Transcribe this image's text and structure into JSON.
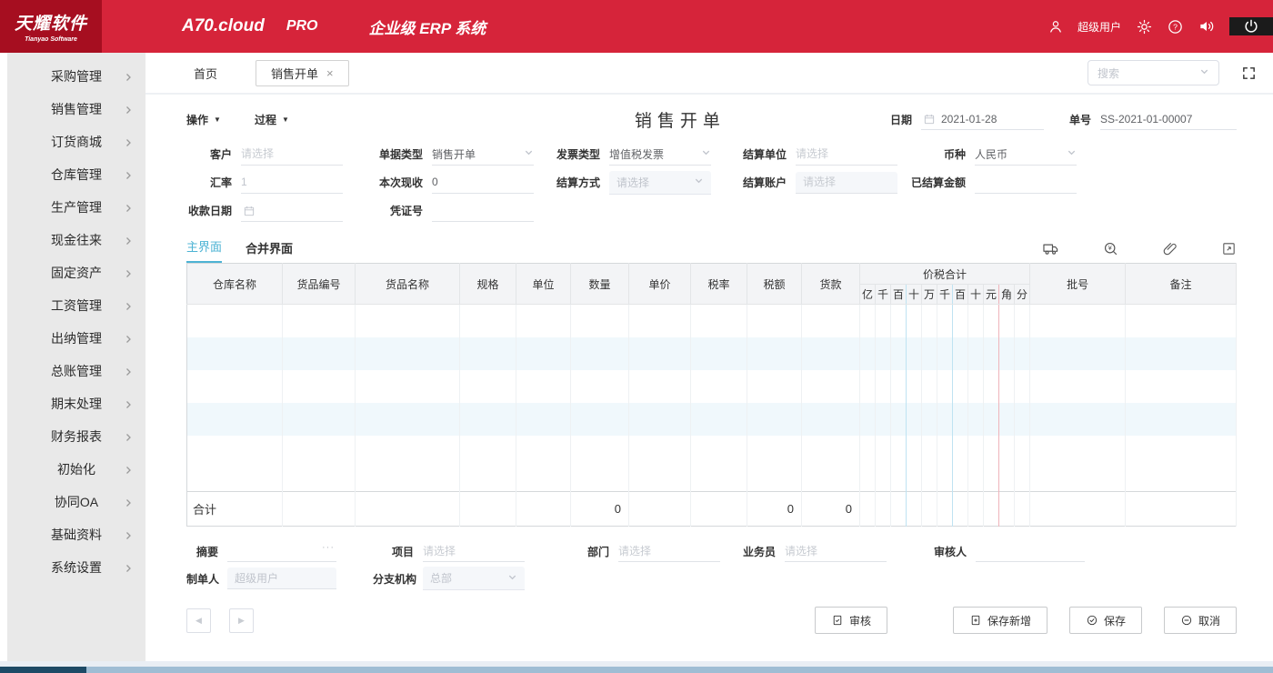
{
  "header": {
    "logo": {
      "title": "天耀软件",
      "subtitle": "Tianyao Software"
    },
    "product": "A70.cloud",
    "edition": "PRO",
    "system_name": "企业级 ERP 系统",
    "username": "超级用户"
  },
  "sidebar": {
    "items": [
      {
        "label": "采购管理"
      },
      {
        "label": "销售管理"
      },
      {
        "label": "订货商城"
      },
      {
        "label": "仓库管理"
      },
      {
        "label": "生产管理"
      },
      {
        "label": "现金往来"
      },
      {
        "label": "固定资产"
      },
      {
        "label": "工资管理"
      },
      {
        "label": "出纳管理"
      },
      {
        "label": "总账管理"
      },
      {
        "label": "期末处理"
      },
      {
        "label": "财务报表"
      },
      {
        "label": "初始化"
      },
      {
        "label": "协同OA"
      },
      {
        "label": "基础资料"
      },
      {
        "label": "系统设置"
      }
    ]
  },
  "tabbar": {
    "home": "首页",
    "active_tab": "销售开单",
    "close": "×",
    "search_placeholder": "搜索"
  },
  "toolbar": {
    "action_menu": "操作",
    "process_menu": "过程",
    "caret": "▼",
    "title": "销售开单",
    "date": {
      "label": "日期",
      "value": "2021-01-28"
    },
    "doc_no": {
      "label": "单号",
      "value": "SS-2021-01-00007"
    }
  },
  "form": {
    "customer": {
      "label": "客户",
      "placeholder": "请选择"
    },
    "doc_type": {
      "label": "单据类型",
      "value": "销售开单"
    },
    "invoice_type": {
      "label": "发票类型",
      "value": "增值税发票"
    },
    "settle_unit": {
      "label": "结算单位",
      "placeholder": "请选择"
    },
    "currency": {
      "label": "币种",
      "value": "人民币"
    },
    "exchange_rate": {
      "label": "汇率",
      "value": "1"
    },
    "cash_received": {
      "label": "本次现收",
      "value": "0"
    },
    "settle_method": {
      "label": "结算方式",
      "placeholder": "请选择"
    },
    "settle_account": {
      "label": "结算账户",
      "placeholder": "请选择"
    },
    "settled_amount": {
      "label": "已结算金额",
      "value": ""
    },
    "receipt_date": {
      "label": "收款日期",
      "value": ""
    },
    "voucher_no": {
      "label": "凭证号",
      "value": ""
    }
  },
  "view_tabs": {
    "main": "主界面",
    "merge": "合并界面"
  },
  "grid": {
    "columns": {
      "warehouse": "仓库名称",
      "item_no": "货品编号",
      "item_name": "货品名称",
      "spec": "规格",
      "unit": "单位",
      "qty": "数量",
      "price": "单价",
      "tax_rate": "税率",
      "tax": "税额",
      "amount": "货款",
      "batch": "批号",
      "remark": "备注"
    },
    "amount_group": {
      "label": "价税合计",
      "digits": [
        "亿",
        "千",
        "百",
        "十",
        "万",
        "千",
        "百",
        "十",
        "元",
        "角",
        "分"
      ]
    },
    "totals": {
      "label": "合计",
      "qty": "0",
      "tax": "0",
      "amount": "0"
    },
    "empty_body_rows": 4
  },
  "footer_form": {
    "summary": {
      "label": "摘要",
      "more": "···"
    },
    "project": {
      "label": "项目",
      "placeholder": "请选择"
    },
    "department": {
      "label": "部门",
      "placeholder": "请选择"
    },
    "salesman": {
      "label": "业务员",
      "placeholder": "请选择"
    },
    "auditor": {
      "label": "审核人",
      "value": ""
    },
    "creator": {
      "label": "制单人",
      "value": "超级用户"
    },
    "branch": {
      "label": "分支机构",
      "value": "总部"
    }
  },
  "actions": {
    "audit": "审核",
    "save_new": "保存新增",
    "save": "保存",
    "cancel": "取消"
  },
  "nav": {
    "prev": "◀",
    "next": "▶"
  },
  "icons": {
    "person-icon": "svg-person-outline",
    "gear-icon": "svg-gear",
    "help-icon": "svg-circle-question",
    "speaker-icon": "svg-speaker-waves",
    "power-icon": "svg-power",
    "search-fullscreen-icon": "svg-corner-brackets",
    "calendar-icon": "svg-calendar",
    "chevron-down-icon": "svg-chevron-down",
    "chevron-right-icon": "svg-chevron-right",
    "truck-icon": "svg-delivery-truck",
    "price-search-icon": "svg-magnifier-yuan",
    "attachment-icon": "svg-paperclip",
    "expand-icon": "svg-box-diagonal-arrow",
    "audit-icon": "svg-document-check",
    "save-new-icon": "svg-document-plus",
    "save-icon": "svg-circle-check",
    "cancel-icon": "svg-circle-minus"
  },
  "colors": {
    "brand_red": "#d6243a",
    "logo_red": "#a60e20",
    "power_black": "#1b1b1b",
    "sidebar_gray": "#e9e9e9",
    "accent_blue": "#4db3d4",
    "alt_row_blue": "#f0f8fc",
    "digit_blue_line": "#bfe3f2",
    "digit_red_line": "#efb4bb",
    "scroll_track": "#9fbdd4",
    "scroll_thumb": "#1d4a66"
  }
}
